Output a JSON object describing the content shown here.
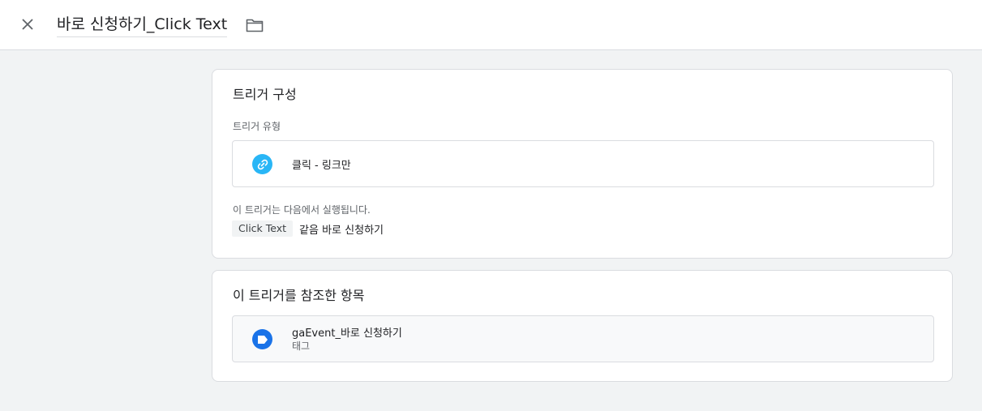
{
  "header": {
    "close_icon": "close-icon",
    "title": "바로 신청하기_Click Text",
    "folder_icon": "folder-icon"
  },
  "trigger_config": {
    "title": "트리거 구성",
    "type_label": "트리거 유형",
    "type_value": "클릭 - 링크만",
    "type_icon": "link-icon",
    "type_icon_color": "#29b6f6",
    "fires_on_label": "이 트리거는 다음에서 실행됩니다.",
    "condition": {
      "variable": "Click Text",
      "operator_value": "같음 바로 신청하기"
    }
  },
  "references": {
    "title": "이 트리거를 참조한 항목",
    "items": [
      {
        "name": "gaEvent_바로 신청하기",
        "type": "태그",
        "icon": "tag-icon",
        "icon_color": "#1a73e8"
      }
    ]
  }
}
